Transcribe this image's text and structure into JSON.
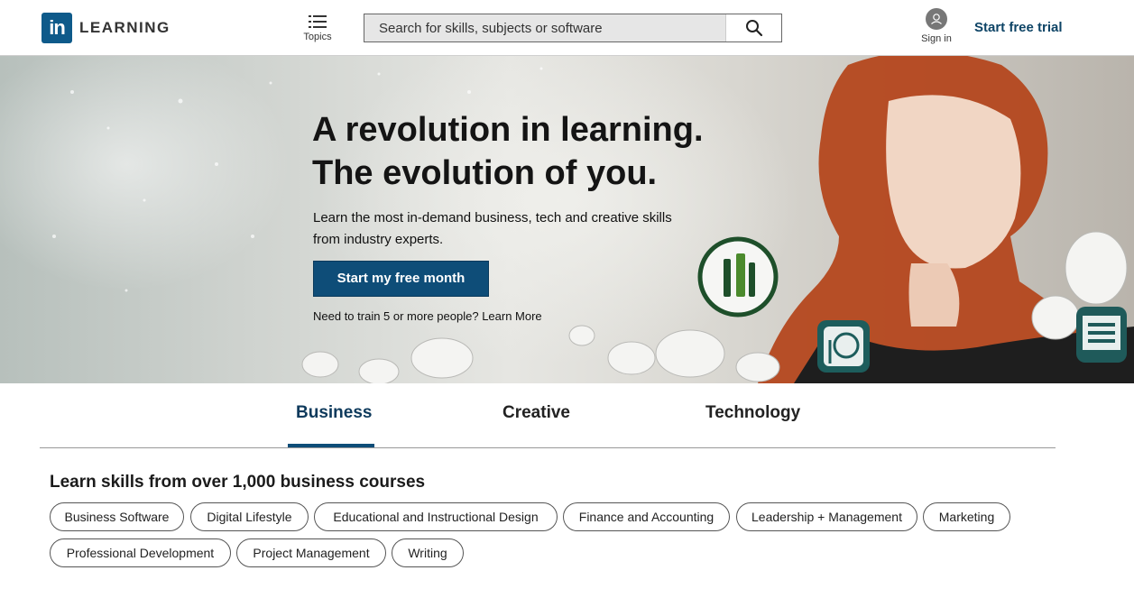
{
  "header": {
    "logo_mark": "in",
    "logo_text": "LEARNING",
    "topics_label": "Topics",
    "search_placeholder": "Search for skills, subjects or software",
    "signin_label": "Sign in",
    "trial_label": "Start free trial"
  },
  "hero": {
    "title_line1": "A revolution in learning.",
    "title_line2": "The evolution of you.",
    "subtitle": "Learn the most in-demand business, tech and creative skills from industry experts.",
    "cta_label": "Start my free month",
    "team_text": "Need to train 5 or more people?",
    "team_link": "Learn More"
  },
  "tabs": [
    {
      "label": "Business",
      "active": true
    },
    {
      "label": "Creative",
      "active": false
    },
    {
      "label": "Technology",
      "active": false
    }
  ],
  "courses": {
    "title": "Learn skills from over 1,000 business courses",
    "topics": [
      "Business Software",
      "Digital Lifestyle",
      "Educational and Instructional Design",
      "Finance and Accounting",
      "Leadership + Management",
      "Marketing",
      "Professional Development",
      "Project Management",
      "Writing"
    ]
  },
  "colors": {
    "brand": "#0e4d78",
    "link": "#0e4466",
    "hero_hair": "#b4471e"
  },
  "icons": [
    "topics-menu-icon",
    "search-icon",
    "user-icon",
    "paint-brushes-icon",
    "design-tool-icon",
    "video-edit-icon"
  ]
}
